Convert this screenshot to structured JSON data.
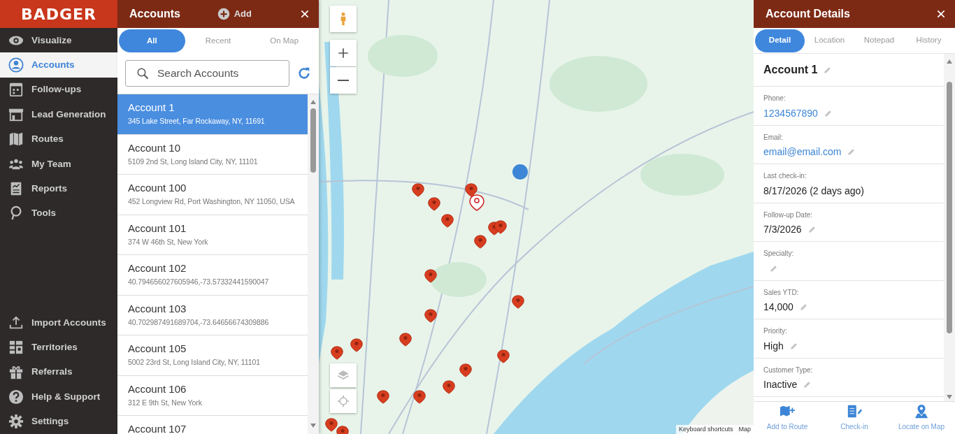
{
  "brand": "BADGER",
  "nav": [
    {
      "label": "Visualize",
      "selected": false
    },
    {
      "label": "Accounts",
      "selected": true
    },
    {
      "label": "Follow-ups",
      "selected": false
    },
    {
      "label": "Lead Generation",
      "selected": false
    },
    {
      "label": "Routes",
      "selected": false
    },
    {
      "label": "My Team",
      "selected": false
    },
    {
      "label": "Reports",
      "selected": false
    },
    {
      "label": "Tools",
      "selected": false
    }
  ],
  "nav_bottom": [
    {
      "label": "Import Accounts",
      "selected": false
    },
    {
      "label": "Territories",
      "selected": false
    },
    {
      "label": "Referrals",
      "selected": false
    },
    {
      "label": "Help & Support",
      "selected": false
    },
    {
      "label": "Settings",
      "selected": false
    }
  ],
  "accounts_panel": {
    "title": "Accounts",
    "add_label": "Add",
    "tabs": [
      {
        "label": "All",
        "selected": true
      },
      {
        "label": "Recent",
        "selected": false
      },
      {
        "label": "On Map",
        "selected": false
      }
    ],
    "search": {
      "placeholder": "Search Accounts"
    },
    "rows": [
      {
        "name": "Account 1",
        "address": "345 Lake Street, Far Rockaway, NY, 11691",
        "selected": true
      },
      {
        "name": "Account 10",
        "address": "5109 2nd St, Long Island City, NY, 11101",
        "selected": false
      },
      {
        "name": "Account 100",
        "address": "452 Longview Rd, Port Washington, NY 11050, USA",
        "selected": false
      },
      {
        "name": "Account 101",
        "address": "374 W 46th St, New York",
        "selected": false
      },
      {
        "name": "Account 102",
        "address": "40.794656027605946,-73.57332441590047",
        "selected": false
      },
      {
        "name": "Account 103",
        "address": "40.702987491689704,-73.64656674309886",
        "selected": false
      },
      {
        "name": "Account 105",
        "address": "5002 23rd St, Long Island City, NY, 11101",
        "selected": false
      },
      {
        "name": "Account 106",
        "address": "312 E 9th St, New York",
        "selected": false
      },
      {
        "name": "Account 107",
        "selected": false
      }
    ]
  },
  "map": {
    "attribution": [
      "Keyboard shortcuts",
      "Map"
    ]
  },
  "details_panel": {
    "title": "Account Details",
    "tabs": [
      {
        "label": "Detail",
        "selected": true
      },
      {
        "label": "Location",
        "selected": false
      },
      {
        "label": "Notepad",
        "selected": false
      },
      {
        "label": "History",
        "selected": false
      }
    ],
    "name": "Account 1",
    "fields": [
      {
        "label": "Phone:",
        "value": "1234567890",
        "link": true,
        "editable": true
      },
      {
        "label": "Email:",
        "value": "email@email.com",
        "link": true,
        "editable": true
      },
      {
        "label": "Last check-in:",
        "value": "8/17/2026 (2 days ago)",
        "link": false,
        "editable": false
      },
      {
        "label": "Follow-up Date:",
        "value": "7/3/2026",
        "link": false,
        "editable": true
      },
      {
        "label": "Specialty:",
        "editable": true
      },
      {
        "label": "Sales YTD:",
        "value": "14,000",
        "link": false,
        "editable": true
      },
      {
        "label": "Priority:",
        "value": "High",
        "link": false,
        "editable": true
      },
      {
        "label": "Customer Type:",
        "value": "Inactive",
        "link": false,
        "editable": true
      }
    ],
    "actions": [
      {
        "label": "Add to Route"
      },
      {
        "label": "Check-in"
      },
      {
        "label": "Locate on Map"
      }
    ]
  }
}
